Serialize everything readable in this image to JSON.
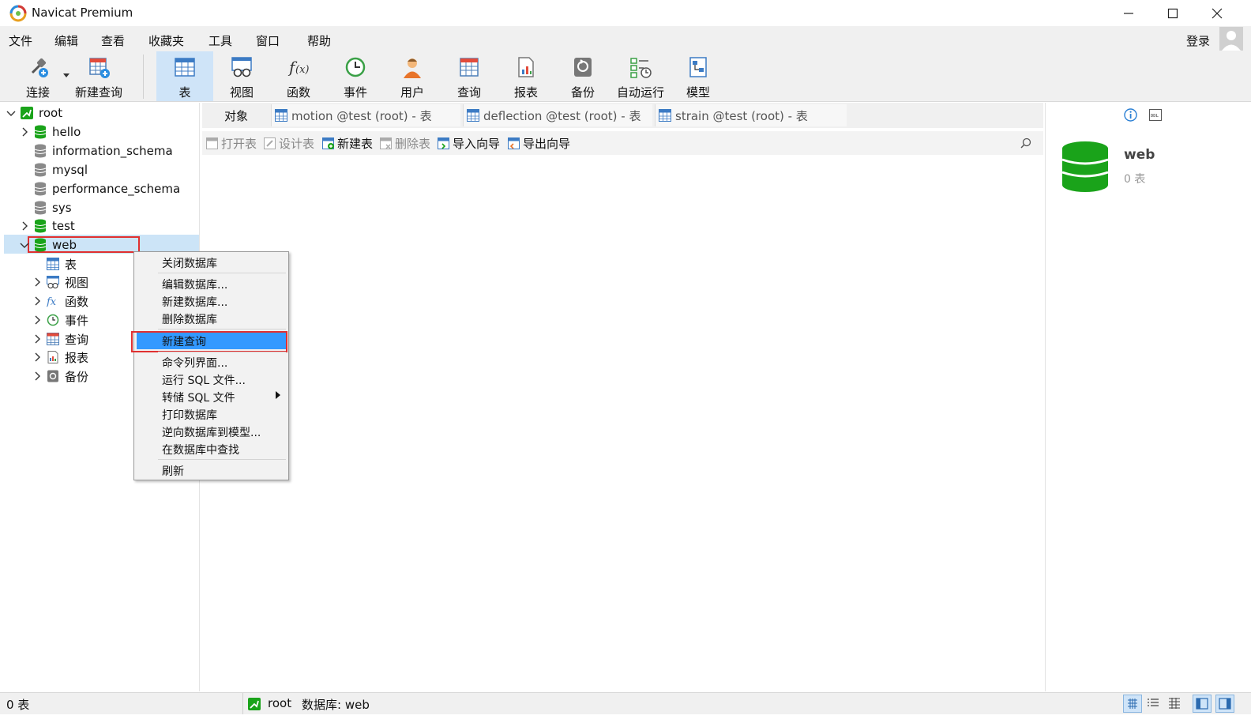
{
  "window": {
    "title": "Navicat Premium"
  },
  "menu": [
    "文件",
    "编辑",
    "查看",
    "收藏夹",
    "工具",
    "窗口",
    "帮助"
  ],
  "account": {
    "login_label": "登录"
  },
  "toolbar": {
    "items": [
      {
        "label": "连接",
        "icon": "connection-plug-icon"
      },
      {
        "label": "新建查询",
        "icon": "new-query-icon"
      },
      {
        "label": "表",
        "icon": "table-icon",
        "active": true
      },
      {
        "label": "视图",
        "icon": "view-icon"
      },
      {
        "label": "函数",
        "icon": "function-icon"
      },
      {
        "label": "事件",
        "icon": "event-clock-icon"
      },
      {
        "label": "用户",
        "icon": "user-icon"
      },
      {
        "label": "查询",
        "icon": "query-icon"
      },
      {
        "label": "报表",
        "icon": "report-icon"
      },
      {
        "label": "备份",
        "icon": "backup-icon"
      },
      {
        "label": "自动运行",
        "icon": "automation-icon"
      },
      {
        "label": "模型",
        "icon": "model-icon"
      }
    ]
  },
  "tree": {
    "connection": "root",
    "databases": [
      "hello",
      "information_schema",
      "mysql",
      "performance_schema",
      "sys",
      "test",
      "web"
    ],
    "web_children": [
      "表",
      "视图",
      "函数",
      "事件",
      "查询",
      "报表",
      "备份"
    ]
  },
  "tabs": {
    "object_tab": "对象",
    "open": [
      "motion @test (root) - 表",
      "deflection @test (root) - 表",
      "strain @test (root) - 表"
    ]
  },
  "object_toolbar": {
    "open_table": "打开表",
    "design_table": "设计表",
    "new_table": "新建表",
    "delete_table": "删除表",
    "import_wizard": "导入向导",
    "export_wizard": "导出向导"
  },
  "context_menu": {
    "items": [
      "关闭数据库",
      "编辑数据库...",
      "新建数据库...",
      "删除数据库",
      "新建查询",
      "命令列界面...",
      "运行 SQL 文件...",
      "转储 SQL 文件",
      "打印数据库",
      "逆向数据库到模型...",
      "在数据库中查找",
      "刷新"
    ],
    "highlighted": "新建查询"
  },
  "info_panel": {
    "db_name": "web",
    "table_count": "0 表"
  },
  "status": {
    "left": "0 表",
    "connection": "root",
    "database": "数据库: web"
  },
  "colors": {
    "db_green": "#1aa31a",
    "highlight": "#3399ff",
    "red_box": "#e03030",
    "active_tool": "#cfe4f8"
  }
}
